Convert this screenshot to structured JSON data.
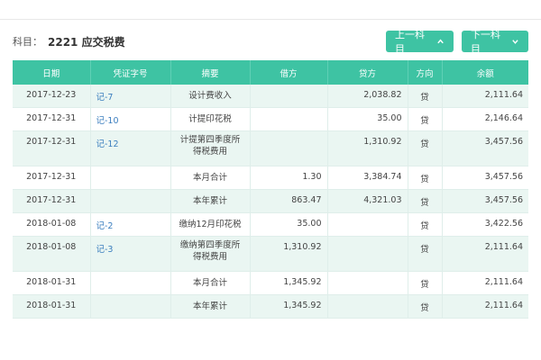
{
  "header": {
    "subject_prefix": "科目：",
    "subject_value": "2221 应交税费",
    "prev_button": "上一科目",
    "next_button": "下一科目"
  },
  "table": {
    "columns": [
      "日期",
      "凭证字号",
      "摘要",
      "借方",
      "贷方",
      "方向",
      "余额"
    ],
    "rows": [
      {
        "date": "2017-12-23",
        "voucher": "记-7",
        "summary": "设计费收入",
        "debit": "",
        "credit": "2,038.82",
        "direction": "贷",
        "balance": "2,111.64"
      },
      {
        "date": "2017-12-31",
        "voucher": "记-10",
        "summary": "计提印花税",
        "debit": "",
        "credit": "35.00",
        "direction": "贷",
        "balance": "2,146.64"
      },
      {
        "date": "2017-12-31",
        "voucher": "记-12",
        "summary": "计提第四季度所得税费用",
        "debit": "",
        "credit": "1,310.92",
        "direction": "贷",
        "balance": "3,457.56"
      },
      {
        "date": "2017-12-31",
        "voucher": "",
        "summary": "本月合计",
        "debit": "1.30",
        "credit": "3,384.74",
        "direction": "贷",
        "balance": "3,457.56"
      },
      {
        "date": "2017-12-31",
        "voucher": "",
        "summary": "本年累计",
        "debit": "863.47",
        "credit": "4,321.03",
        "direction": "贷",
        "balance": "3,457.56"
      },
      {
        "date": "2018-01-08",
        "voucher": "记-2",
        "summary": "缴纳12月印花税",
        "debit": "35.00",
        "credit": "",
        "direction": "贷",
        "balance": "3,422.56"
      },
      {
        "date": "2018-01-08",
        "voucher": "记-3",
        "summary": "缴纳第四季度所得税费用",
        "debit": "1,310.92",
        "credit": "",
        "direction": "贷",
        "balance": "2,111.64"
      },
      {
        "date": "2018-01-31",
        "voucher": "",
        "summary": "本月合计",
        "debit": "1,345.92",
        "credit": "",
        "direction": "贷",
        "balance": "2,111.64"
      },
      {
        "date": "2018-01-31",
        "voucher": "",
        "summary": "本年累计",
        "debit": "1,345.92",
        "credit": "",
        "direction": "贷",
        "balance": "2,111.64"
      }
    ]
  },
  "colors": {
    "accent": "#3ec3a3",
    "row_alt": "#eaf6f2",
    "voucher_link": "#3c7fbf"
  },
  "icons": {
    "prev": "chevron-up-icon",
    "next": "chevron-down-icon"
  }
}
